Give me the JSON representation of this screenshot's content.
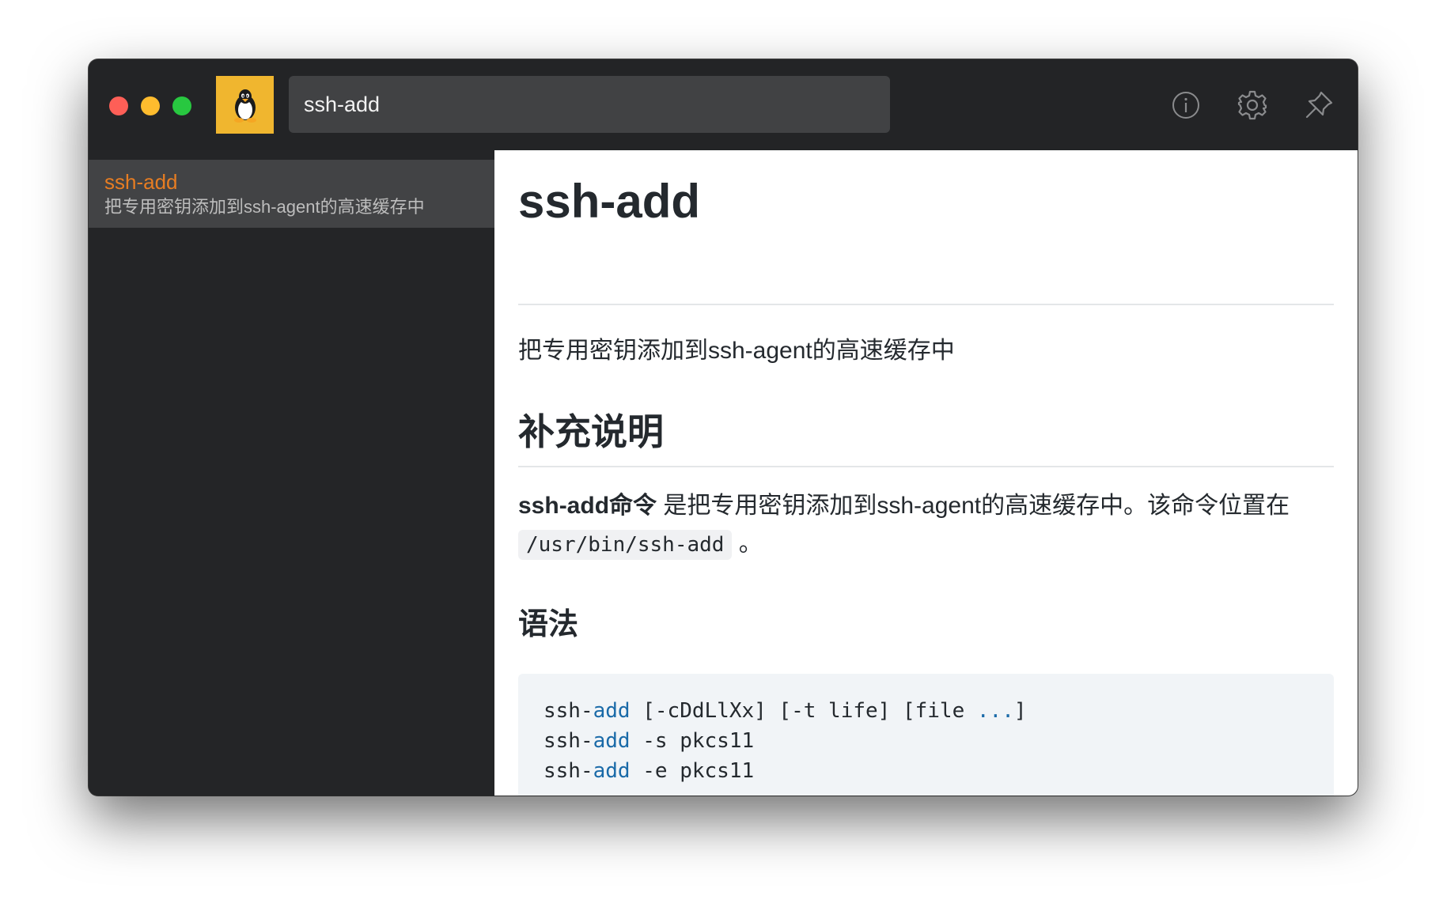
{
  "titlebar": {
    "search_value": "ssh-add",
    "icons": [
      "info-icon",
      "gear-icon",
      "pin-icon"
    ],
    "logo": "tux-penguin-icon"
  },
  "sidebar": {
    "items": [
      {
        "title": "ssh-add",
        "desc": "把专用密钥添加到ssh-agent的高速缓存中"
      }
    ]
  },
  "content": {
    "title": "ssh-add",
    "summary": "把专用密钥添加到ssh-agent的高速缓存中",
    "section_heading": "补充说明",
    "desc_bold": "ssh-add命令",
    "desc_text": " 是把专用密钥添加到ssh-agent的高速缓存中。该命令位置在 ",
    "desc_code": "/usr/bin/ssh-add",
    "desc_end": " 。",
    "syntax_heading": "语法",
    "code_lines": [
      {
        "pre": "ssh-",
        "kw": "add",
        "mid": " [-cDdLlXx] [-t life] [file ",
        "kw2": "...",
        "post": "]"
      },
      {
        "pre": "ssh-",
        "kw": "add",
        "mid": " -s pkcs11",
        "kw2": "",
        "post": ""
      },
      {
        "pre": "ssh-",
        "kw": "add",
        "mid": " -e pkcs11",
        "kw2": "",
        "post": ""
      }
    ]
  },
  "colors": {
    "accent_orange": "#e77d22",
    "logo_bg": "#f0b62f",
    "keyword_blue": "#1a6aa8"
  }
}
